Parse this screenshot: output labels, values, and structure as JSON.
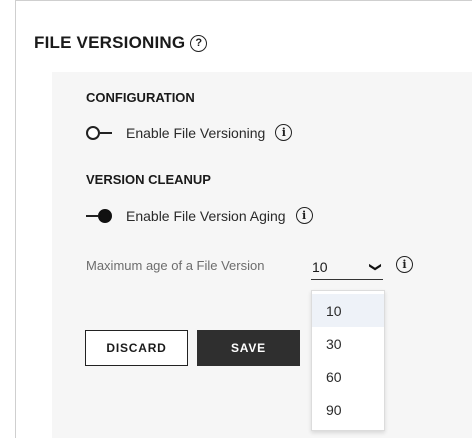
{
  "page": {
    "title": "FILE VERSIONING",
    "help_glyph": "?"
  },
  "configuration": {
    "heading": "CONFIGURATION",
    "toggle_label": "Enable File Versioning",
    "toggle_state": "off"
  },
  "cleanup": {
    "heading": "VERSION CLEANUP",
    "toggle_label": "Enable File Version Aging",
    "toggle_state": "on"
  },
  "max_age": {
    "label": "Maximum age of a File Version",
    "selected": "10",
    "options": [
      "10",
      "30",
      "60",
      "90"
    ]
  },
  "buttons": {
    "discard": "DISCARD",
    "save": "SAVE"
  },
  "icons": {
    "info_glyph": "i"
  },
  "colors": {
    "card_bg": "#f6f6f6",
    "save_bg": "#2f2f2f",
    "option_highlight": "#eef2f8"
  }
}
